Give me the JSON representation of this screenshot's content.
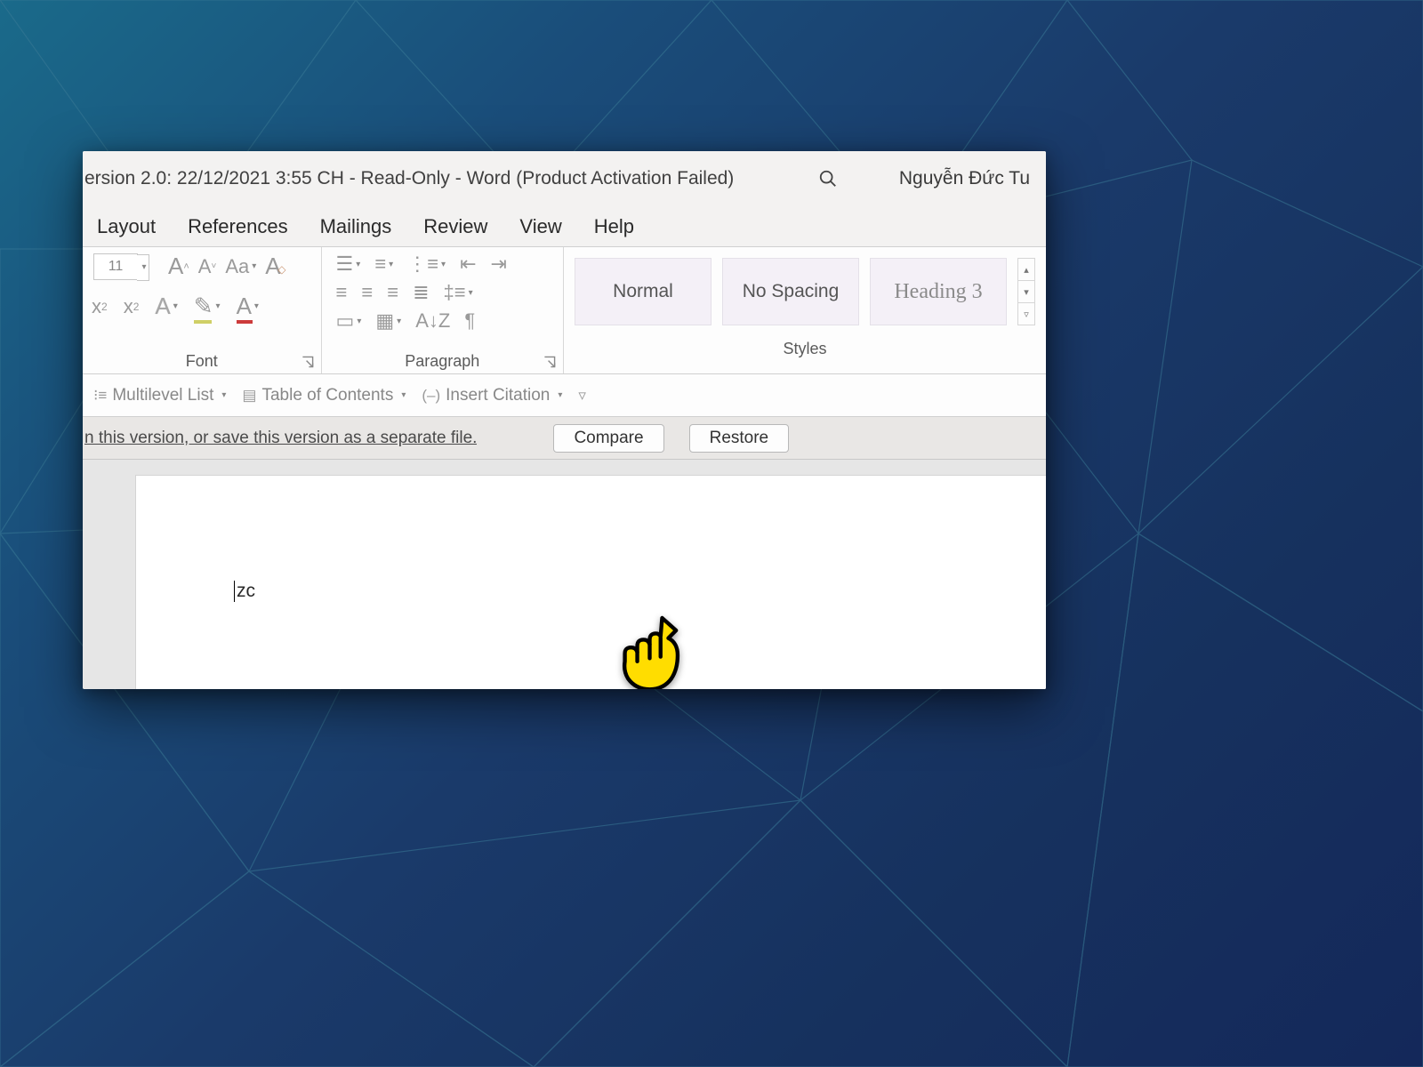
{
  "title": "ersion 2.0: 22/12/2021 3:55 CH  -  Read-Only  -  Word (Product Activation Failed)",
  "user": "Nguyễn Đức Tu",
  "tabs": {
    "layout": "Layout",
    "references": "References",
    "mailings": "Mailings",
    "review": "Review",
    "view": "View",
    "help": "Help"
  },
  "font": {
    "size": "11",
    "groupLabel": "Font"
  },
  "paragraph": {
    "groupLabel": "Paragraph"
  },
  "styles": {
    "groupLabel": "Styles",
    "normal": "Normal",
    "nospacing": "No Spacing",
    "heading3": "Heading 3"
  },
  "qat": {
    "multilevel": "Multilevel List",
    "toc": "Table of Contents",
    "citation": "Insert Citation"
  },
  "infobar": {
    "text": "n this version, or save this version as a separate file.",
    "compare": "Compare",
    "restore": "Restore"
  },
  "doc": {
    "content": "zc"
  }
}
